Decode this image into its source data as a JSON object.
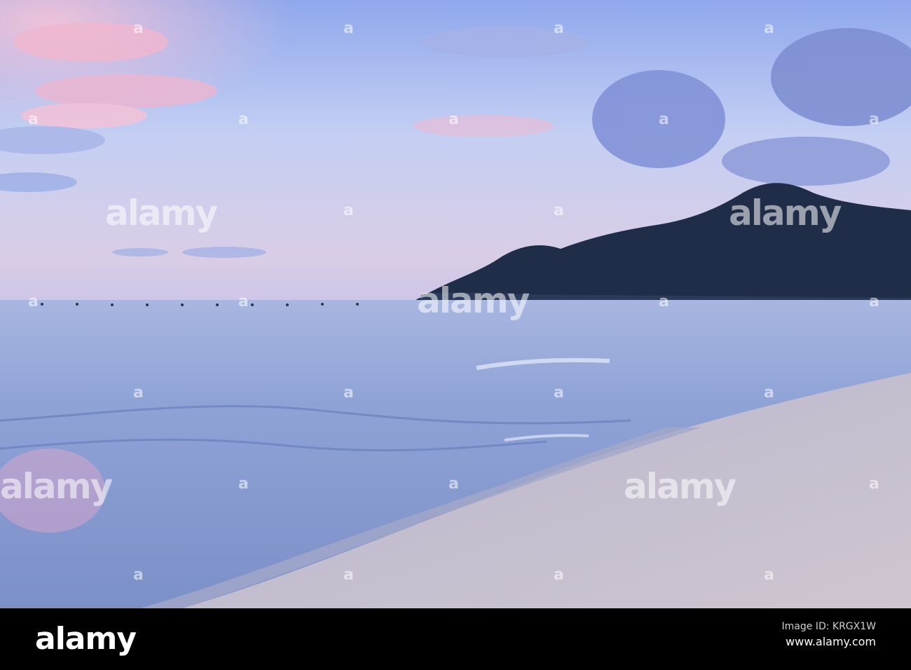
{
  "image": {
    "description_colors": {
      "sky_top": "#7f9ee8",
      "sky_mid": "#c5cdf2",
      "sky_horizon": "#d8c8e4",
      "sea": "#8ea5d8",
      "sea_dark": "#5c78b8",
      "sand": "#c4c0d2",
      "hill": "#1e2e4a",
      "pink_cloud": "#f2b4cc"
    }
  },
  "watermarks": {
    "text": "alamy",
    "mark": "a"
  },
  "footer": {
    "logo": "alamy",
    "image_id_label": "Image ID: KRGX1W",
    "site": "www.alamy.com"
  }
}
